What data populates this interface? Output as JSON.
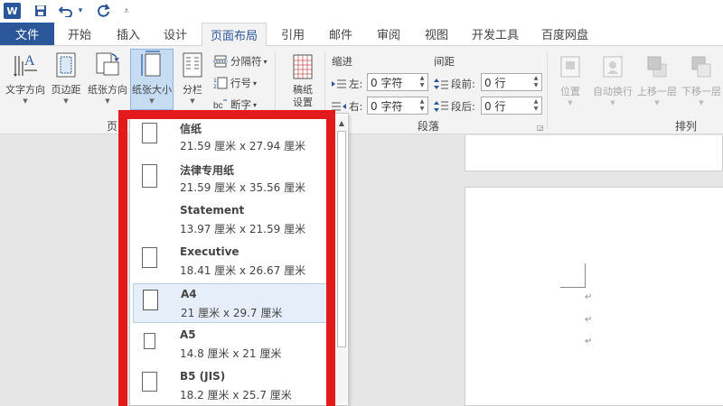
{
  "titlebar": {
    "app_logo": "W",
    "qat": [
      {
        "icon": "save-icon",
        "glyph": "💾"
      },
      {
        "icon": "undo-icon",
        "glyph": "↶"
      },
      {
        "icon": "undo-dropdown-icon",
        "glyph": "▾"
      },
      {
        "icon": "redo-icon",
        "glyph": "↻"
      },
      {
        "icon": "customize-qat-icon",
        "glyph": "₹"
      }
    ]
  },
  "tabs": {
    "file": "文件",
    "items": [
      "开始",
      "插入",
      "设计",
      "页面布局",
      "引用",
      "邮件",
      "审阅",
      "视图",
      "开发工具",
      "百度网盘"
    ],
    "active": "页面布局"
  },
  "ribbon": {
    "page_setup": {
      "text_direction": "文字方向",
      "margins": "页边距",
      "orientation": "纸张方向",
      "size": "纸张大小",
      "columns": "分栏",
      "breaks": "分隔符",
      "line_numbers": "行号",
      "hyphenation": "断字",
      "group_label_partial": "页"
    },
    "draft": {
      "label_line1": "稿纸",
      "label_line2": "设置"
    },
    "paragraph": {
      "indent_title": "缩进",
      "spacing_title": "间距",
      "left_label": "左:",
      "right_label": "右:",
      "before_label": "段前:",
      "after_label": "段后:",
      "left_value": "0 字符",
      "right_value": "0 字符",
      "before_value": "0 行",
      "after_value": "0 行",
      "group_label": "段落"
    },
    "arrange": {
      "position": "位置",
      "wrap_text": "自动换行",
      "bring_forward": "上移一层",
      "send_backward": "下移一层",
      "group_label": "排列"
    }
  },
  "paper_sizes": [
    {
      "name": "信纸",
      "size": "21.59 厘米 x 27.94 厘米",
      "has_icon": true,
      "selected": false
    },
    {
      "name": "法律专用纸",
      "size": "21.59 厘米 x 35.56 厘米",
      "has_icon": true,
      "selected": false
    },
    {
      "name": "Statement",
      "size": "13.97 厘米 x 21.59 厘米",
      "has_icon": false,
      "selected": false
    },
    {
      "name": "Executive",
      "size": "18.41 厘米 x 26.67 厘米",
      "has_icon": true,
      "selected": false
    },
    {
      "name": "A4",
      "size": "21 厘米 x 29.7 厘米",
      "has_icon": true,
      "selected": true
    },
    {
      "name": "A5",
      "size": "14.8 厘米 x 21 厘米",
      "has_icon": true,
      "selected": false
    },
    {
      "name": "B5 (JIS)",
      "size": "18.2 厘米 x 25.7 厘米",
      "has_icon": true,
      "selected": false
    }
  ],
  "document": {
    "paragraph_marks": [
      "↵",
      "↵",
      "↵"
    ]
  },
  "colors": {
    "accent": "#2b579a",
    "highlight": "#e31a1c",
    "selected_bg": "#e6eff9"
  }
}
